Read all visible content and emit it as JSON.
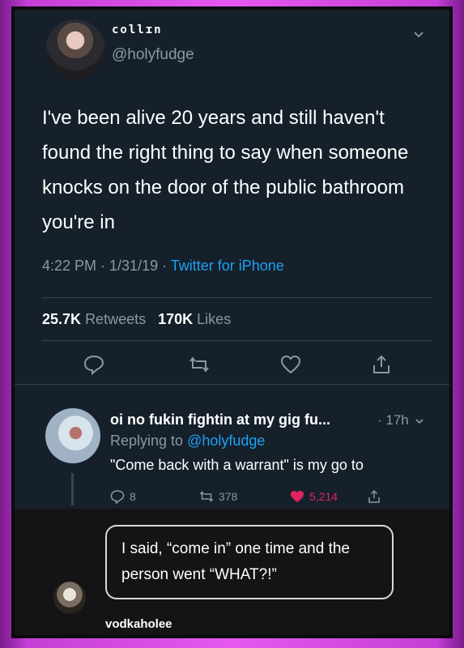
{
  "tweet": {
    "display_name": "collɪn",
    "handle": "@holyfudge",
    "text": "I've been alive 20 years and still haven't found the right thing to say when someone knocks on the door of the public bathroom you're in",
    "time_date": "4:22 PM · 1/31/19 · ",
    "source": "Twitter for iPhone",
    "retweets_count": "25.7K",
    "retweets_label": "Retweets",
    "likes_count": "170K",
    "likes_label": "Likes"
  },
  "reply": {
    "display_name": "oi no fukin fightin at my gig fu...",
    "time": "· 17h",
    "replying_to_label": "Replying to",
    "replying_to_handle": "@holyfudge",
    "text": "\"Come back with a warrant\" is my go to",
    "reply_count": "8",
    "retweet_count": "378",
    "like_count": "5,214"
  },
  "comment": {
    "text": "I said, “come in” one time and the person went “WHAT?!”",
    "username": "vodkaholee"
  },
  "colors": {
    "background": "#15202b",
    "link": "#1da1f2",
    "muted": "#8899a6",
    "like": "#e0245e",
    "border": "#e659f0"
  }
}
